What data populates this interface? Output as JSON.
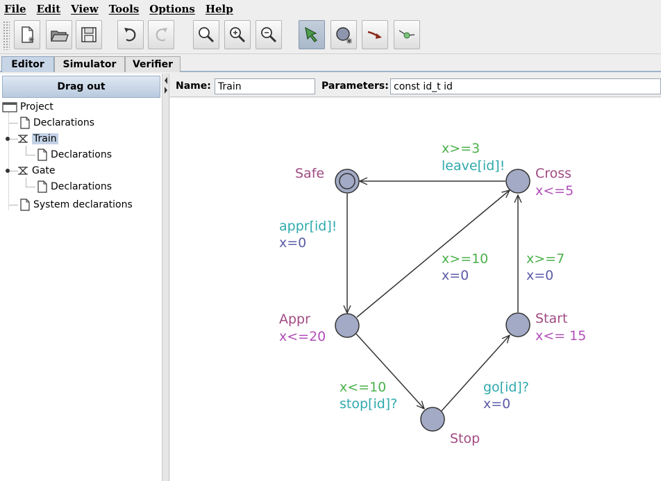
{
  "menu": [
    "File",
    "Edit",
    "View",
    "Tools",
    "Options",
    "Help"
  ],
  "toolbar": {
    "buttons": [
      "new-document",
      "open-folder",
      "save",
      "undo",
      "redo",
      "zoom",
      "zoom-in",
      "zoom-out",
      "select-arrow",
      "add-location",
      "add-edge",
      "add-nail"
    ]
  },
  "tabs": [
    "Editor",
    "Simulator",
    "Verifier"
  ],
  "left": {
    "drag_out": "Drag out",
    "tree": {
      "project": "Project",
      "declarations": "Declarations",
      "train": "Train",
      "train_declarations": "Declarations",
      "gate": "Gate",
      "gate_declarations": "Declarations",
      "system_declarations": "System declarations"
    }
  },
  "editor": {
    "name_label": "Name:",
    "name_value": "Train",
    "params_label": "Parameters:",
    "params_value": "const id_t id"
  },
  "colors": {
    "location_name": "#a04a82",
    "invariant": "#b04fb8",
    "guard": "#4bb04b",
    "sync": "#2ea9ad",
    "update": "#5c5ca8",
    "node_fill": "#a2aac5"
  },
  "automaton": {
    "locations": {
      "safe": {
        "name": "Safe"
      },
      "cross": {
        "name": "Cross",
        "invariant": "x<=5"
      },
      "appr": {
        "name": "Appr",
        "invariant": "x<=20"
      },
      "start": {
        "name": "Start",
        "invariant": "x<= 15"
      },
      "stop": {
        "name": "Stop"
      }
    },
    "edges": {
      "cross_safe": {
        "guard": "x>=3",
        "sync": "leave[id]!"
      },
      "safe_appr": {
        "sync": "appr[id]!",
        "update": "x=0"
      },
      "appr_cross": {
        "guard": "x>=10",
        "update": "x=0"
      },
      "start_cross": {
        "guard": "x>=7",
        "update": "x=0"
      },
      "appr_stop": {
        "guard": "x<=10",
        "sync": "stop[id]?"
      },
      "stop_start": {
        "sync": "go[id]?",
        "update": "x=0"
      }
    }
  }
}
